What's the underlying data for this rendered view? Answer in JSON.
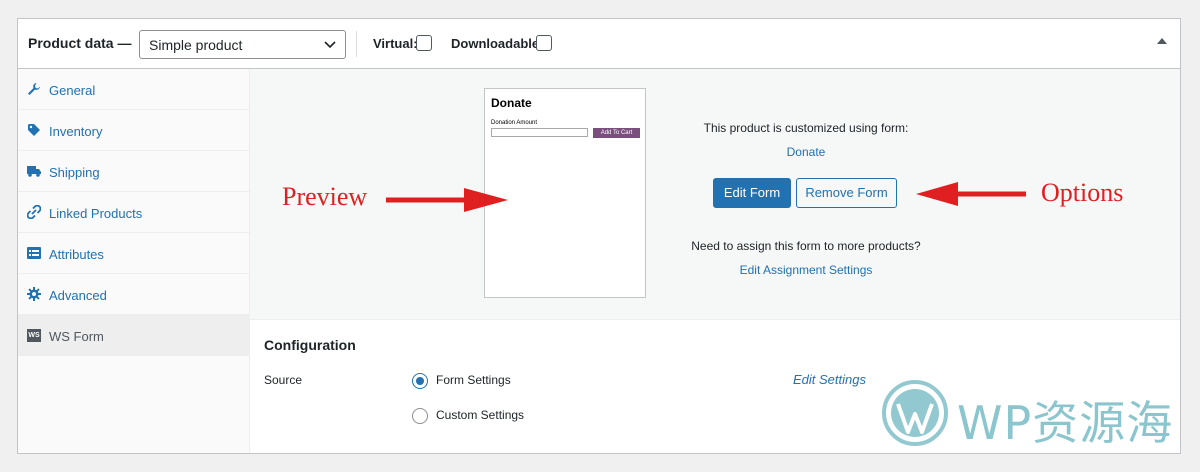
{
  "header": {
    "title": "Product data —",
    "product_type": "Simple product",
    "virtual_label": "Virtual:",
    "downloadable_label": "Downloadable:"
  },
  "sidebar": {
    "items": [
      {
        "label": "General",
        "icon": "wrench-icon"
      },
      {
        "label": "Inventory",
        "icon": "tag-icon"
      },
      {
        "label": "Shipping",
        "icon": "truck-icon"
      },
      {
        "label": "Linked Products",
        "icon": "link-icon"
      },
      {
        "label": "Attributes",
        "icon": "list-icon"
      },
      {
        "label": "Advanced",
        "icon": "gear-icon"
      },
      {
        "label": "WS Form",
        "icon": "ws-form-icon",
        "icon_text": "WS",
        "active": true
      }
    ]
  },
  "preview": {
    "title": "Donate",
    "field_label": "Donation Amount",
    "button_label": "Add To Cart"
  },
  "form_info": {
    "text": "This product is customized using form:",
    "form_name": "Donate",
    "edit_button": "Edit Form",
    "remove_button": "Remove Form",
    "assign_text": "Need to assign this form to more products?",
    "assign_link": "Edit Assignment Settings"
  },
  "annotations": {
    "preview": "Preview",
    "options": "Options"
  },
  "configuration": {
    "title": "Configuration",
    "source_label": "Source",
    "options": [
      {
        "label": "Form Settings",
        "selected": true
      },
      {
        "label": "Custom Settings",
        "selected": false
      }
    ],
    "edit_settings": "Edit Settings"
  },
  "watermark": {
    "text": "WP资源海"
  },
  "colors": {
    "primary": "#2271b1",
    "annotation": "#e02020",
    "watermark": "#7fbfc8",
    "preview_button": "#7a4f7e"
  }
}
